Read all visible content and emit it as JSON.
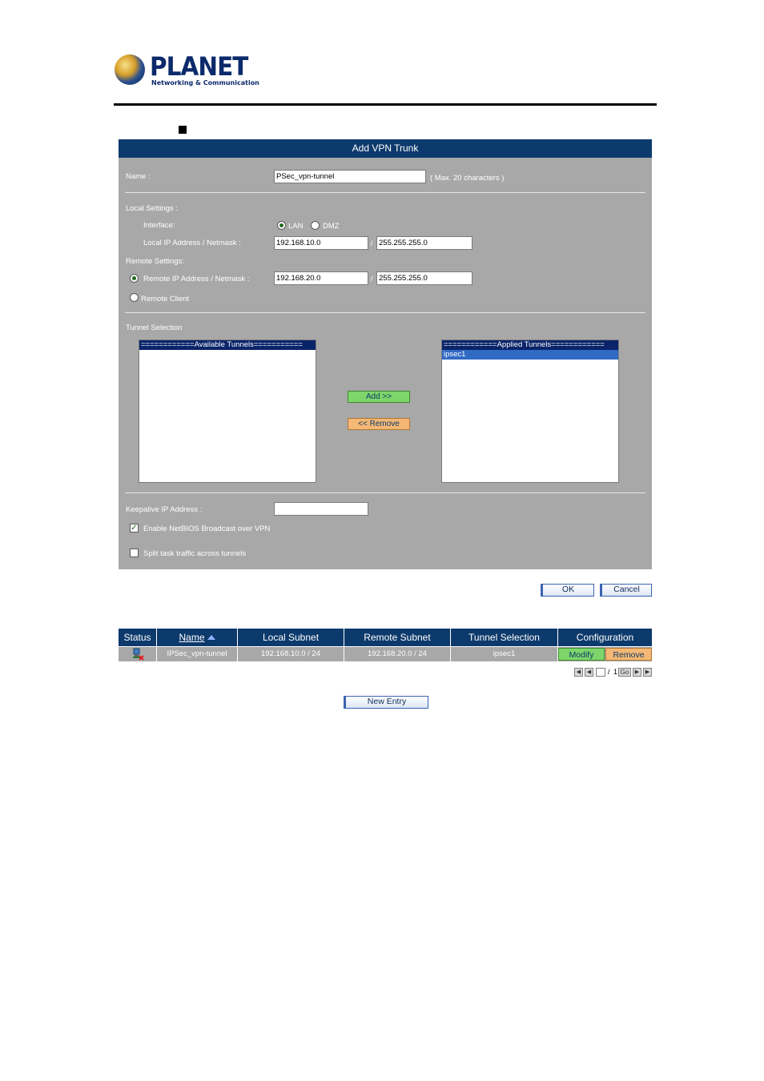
{
  "brand": {
    "name": "PLANET",
    "tagline": "Networking & Communication"
  },
  "form": {
    "title": "Add VPN Trunk",
    "name_label": "Name :",
    "name_value": "PSec_vpn-tunnel",
    "name_hint": "( Max. 20 characters )",
    "local_settings_label": "Local Settings :",
    "interface_label": "Interface:",
    "interface_options": [
      "LAN",
      "DMZ"
    ],
    "interface_selected": "LAN",
    "local_ip_label": "Local IP Address / Netmask :",
    "local_ip": "192.168.10.0",
    "local_mask": "255.255.255.0",
    "remote_settings_label": "Remote Settings:",
    "remote_ip_label": "Remote IP Address / Netmask :",
    "remote_ip": "192.168.20.0",
    "remote_mask": "255.255.255.0",
    "remote_client_label": "Remote Client",
    "slash": "/",
    "tunnel_selection_label": "Tunnel Selection",
    "available_header": "============Available Tunnels===========",
    "applied_header": "============Applied Tunnels============",
    "applied_items": [
      "ipsec1"
    ],
    "add_button": "Add >>",
    "remove_button": "<< Remove",
    "keepalive_label": "Keepalive IP Address :",
    "keepalive_value": "",
    "netbios_label": "Enable NetBIOS Broadcast over VPN",
    "netbios_checked": true,
    "split_label": "Split task traffic across tunnels",
    "split_checked": false,
    "ok_button": "OK",
    "cancel_button": "Cancel"
  },
  "table": {
    "headers": [
      "Status",
      "Name",
      "Local Subnet",
      "Remote Subnet",
      "Tunnel Selection",
      "Configuration"
    ],
    "rows": [
      {
        "name": "IPSec_vpn-tunnel",
        "local_subnet": "192.168.10.0 / 24",
        "remote_subnet": "192.168.20.0 / 24",
        "tunnel_selection": "ipsec1",
        "modify_label": "Modify",
        "remove_label": "Remove"
      }
    ]
  },
  "pager": {
    "current_page": "",
    "separator": "/",
    "total_pages": "1",
    "go_label": "Go"
  },
  "new_entry_button": "New Entry",
  "colors": {
    "header_blue": "#0d3a6c",
    "panel_gray": "#a8a8a8",
    "add_green": "#7ed66a",
    "remove_orange": "#f4b774",
    "selected_blue": "#316ac5"
  }
}
